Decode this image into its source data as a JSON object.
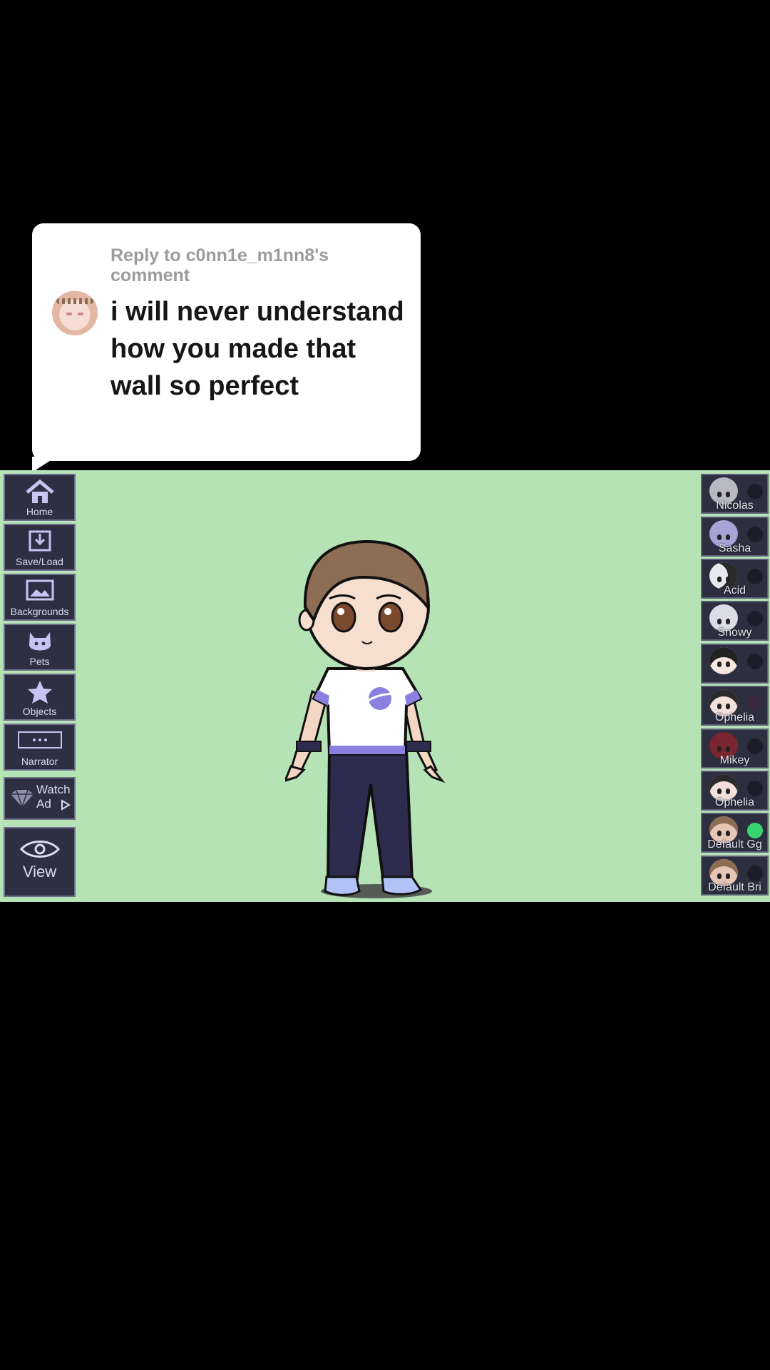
{
  "reply": {
    "header": "Reply to c0nn1e_m1nn8's comment",
    "comment": "i will never understand how you made that wall so perfect"
  },
  "menu": {
    "home": "Home",
    "save_load": "Save/Load",
    "backgrounds": "Backgrounds",
    "pets": "Pets",
    "objects": "Objects",
    "narrator": "Narrator",
    "watch_ad_line1": "Watch",
    "watch_ad_line2": "Ad",
    "view": "View"
  },
  "characters": [
    {
      "name": "Nicolas",
      "color": "#b9b9c2",
      "indicator": "#1c1d28"
    },
    {
      "name": "Sasha",
      "color": "#a7a3d6",
      "indicator": "#1c1d28"
    },
    {
      "name": "Acid",
      "color": "#3a3a3a",
      "indicator": "#1c1d28"
    },
    {
      "name": "Snowy",
      "color": "#dcdce8",
      "indicator": "#1c1d28"
    },
    {
      "name": "",
      "color": "#2a2a2a",
      "indicator": "#1c1d28"
    },
    {
      "name": "Ophelia",
      "color": "#f3e0da",
      "indicator": "#3a2a40"
    },
    {
      "name": "Mikey",
      "color": "#7a2630",
      "indicator": "#1c1d28"
    },
    {
      "name": "Ophelia",
      "color": "#f3e0da",
      "indicator": "#1c1d28"
    },
    {
      "name": "Default Gg",
      "color": "#e7c6b6",
      "indicator": "#39d46f"
    },
    {
      "name": "Default Bri",
      "color": "#e7c6b6",
      "indicator": "#1c1d28"
    }
  ],
  "colors": {
    "stage_background": "#b6e3b6",
    "menu_button": "#2e2f42",
    "accent_purple": "#8b7fe0"
  }
}
